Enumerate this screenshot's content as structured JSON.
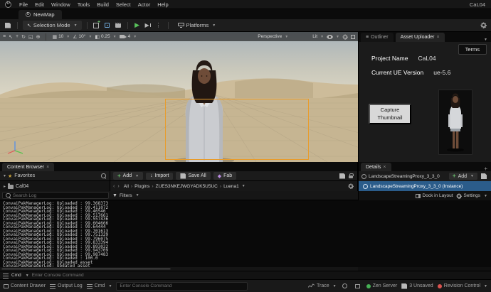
{
  "window": {
    "title_right": "CaL04"
  },
  "menu": {
    "items": [
      "File",
      "Edit",
      "Window",
      "Tools",
      "Build",
      "Select",
      "Actor",
      "Help"
    ]
  },
  "tabs": {
    "level_tab": "NewMap"
  },
  "toolbar": {
    "selection_mode_label": "Selection Mode",
    "platforms_label": "Platforms"
  },
  "viewport": {
    "perspective_label": "Perspective",
    "lit_label": "Lit",
    "snap": {
      "location": "10",
      "rotation": "10°",
      "scale": "0.25",
      "camera_speed": "4"
    }
  },
  "outliner": {
    "tab_label": "Outliner"
  },
  "asset_uploader": {
    "tab_label": "Asset Uploader",
    "terms_button": "Terms",
    "project_name_label": "Project Name",
    "project_name_value": "CaL04",
    "ue_version_label": "Current UE Version",
    "ue_version_value": "ue-5.6",
    "capture_thumbnail_button": "Capture Thumbnail"
  },
  "content_browser": {
    "tab_label": "Content Browser",
    "favorites_label": "Favorites",
    "tree_item": "Cal04",
    "add_button": "Add",
    "import_button": "Import",
    "save_all_button": "Save All",
    "fab_button": "Fab",
    "breadcrumb": [
      "All",
      "Plugins",
      "ZUES3NKEJWGYADK5U5UC",
      "Luena1"
    ]
  },
  "details": {
    "tab_label": "Details",
    "object_name": "LandscapeStreamingProxy_3_3_0",
    "add_button": "Add",
    "instance_name": "LandscapeStreamingProxy_3_3_0 (Instance)",
    "dock_button": "Dock in Layout",
    "settings_label": "Settings"
  },
  "output_log": {
    "search_placeholder": "Search Log",
    "filters_label": "Filters",
    "cmd_label": "Cmd",
    "console_placeholder": "Enter Console Command",
    "lines": [
      "ConvaiPakManagerLog: Uploaded : 99.368373",
      "ConvaiPakManagerLog: Uploaded : 99.411072",
      "ConvaiPakManagerLog: Uploaded : 99.46546",
      "ConvaiPakManagerLog: Uploaded : 99.517661",
      "ConvaiPakManagerLog: Uploaded : 99.557436",
      "ConvaiPakManagerLog: Uploaded : 99.604666",
      "ConvaiPakManagerLog: Uploaded : 99.64444",
      "ConvaiPakManagerLog: Uploaded : 99.701613",
      "ConvaiPakManagerLog: Uploaded : 99.751329",
      "ConvaiPakManagerLog: Uploaded : 99.796075",
      "ConvaiPakManagerLog: Uploaded : 99.833394",
      "ConvaiPakManagerLog: Uploaded : 99.893022",
      "ConvaiPakManagerLog: Uploaded : 99.943709",
      "ConvaiPakManagerLog: Uploaded : 99.987483",
      "ConvaiPakManagerLog: Uploaded : 100.0",
      "ConvaiPakManagerLog: Uploaded asset",
      "ConvaiPakManagerLog: Updated asset"
    ]
  },
  "status_bar": {
    "content_drawer": "Content Drawer",
    "output_log": "Output Log",
    "cmd_label": "Cmd",
    "console_placeholder": "Enter Console Command",
    "trace_label": "Trace",
    "zen_server": "Zen Server",
    "unsaved": "3 Unsaved",
    "revision_control": "Revision Control"
  }
}
